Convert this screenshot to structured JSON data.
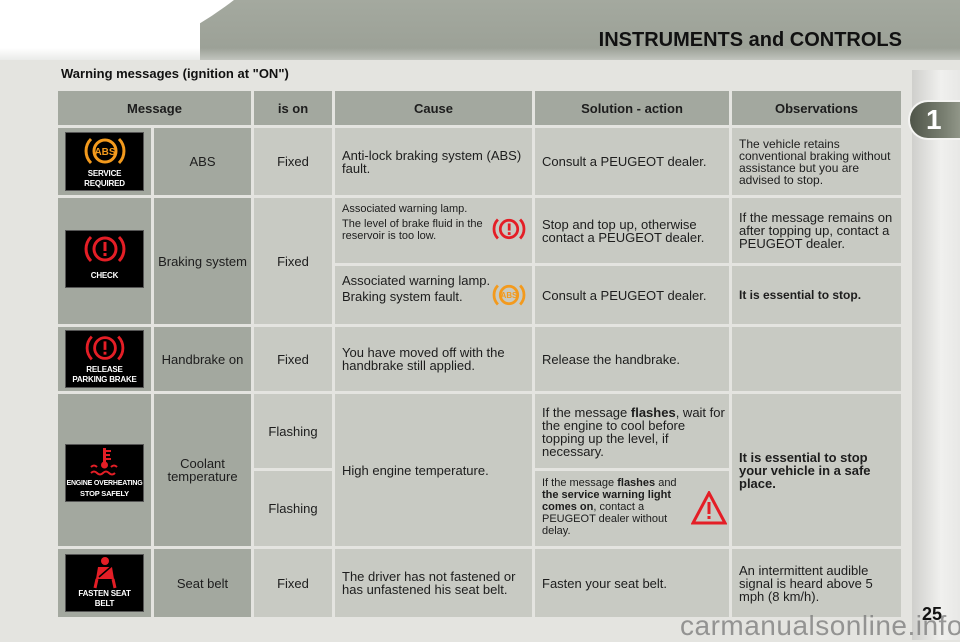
{
  "header": {
    "title": "INSTRUMENTS and CONTROLS",
    "section_title": "Warning messages (ignition at \"ON\")",
    "chapter_tab": "1",
    "page_number": "25",
    "watermark": "carmanualsonline.info"
  },
  "table": {
    "columns": [
      "Message",
      "is on",
      "Cause",
      "Solution - action",
      "Observations"
    ],
    "rows": [
      {
        "lamp_icon": "abs-icon",
        "lamp_label": [
          "SERVICE",
          "REQUIRED"
        ],
        "message": "ABS",
        "is_on": "Fixed",
        "cause": "Anti-lock braking system (ABS) fault.",
        "solution": "Consult a PEUGEOT dealer.",
        "observations": "The vehicle retains conventional braking without assistance but you are advised to stop."
      },
      {
        "lamp_icon": "brake-warning-icon",
        "lamp_label": [
          "CHECK"
        ],
        "message": "Braking system",
        "is_on": "Fixed",
        "sub": [
          {
            "cause_line1": "Associated warning lamp.",
            "cause_line2": "The level of brake fluid in the reservoir is too low.",
            "cause_icon": "brake-warning-icon",
            "solution": "Stop and top up, otherwise contact a PEUGEOT dealer.",
            "observations": "If the message remains on after topping up, contact a PEUGEOT dealer."
          },
          {
            "cause_line1": "Associated warning lamp.",
            "cause_line2": "Braking system fault.",
            "cause_icon": "abs-icon",
            "solution": "Consult a PEUGEOT dealer.",
            "observations": "It is essential to stop."
          }
        ]
      },
      {
        "lamp_icon": "brake-warning-icon",
        "lamp_label": [
          "RELEASE",
          "PARKING BRAKE"
        ],
        "message": "Handbrake on",
        "is_on": "Fixed",
        "cause": "You have moved off with the handbrake still applied.",
        "solution": "Release the handbrake.",
        "observations": ""
      },
      {
        "lamp_icon": "coolant-temperature-icon",
        "lamp_label": [
          "ENGINE OVERHEATING",
          "STOP SAFELY"
        ],
        "message": "Coolant temperature",
        "is_on_1": "Flashing",
        "is_on_2": "Flashing",
        "cause": "High engine temperature.",
        "solution_1_parts": [
          "If the message ",
          "flashes",
          ", wait for the engine to cool before topping up the level, if necessary."
        ],
        "solution_2_parts": [
          "If the message ",
          "flashes",
          " and ",
          "the service warning light comes on",
          ", contact a PEUGEOT dealer without delay."
        ],
        "solution_2_icon": "warning-triangle-icon",
        "observations": "It is essential to stop your vehicle in a safe place."
      },
      {
        "lamp_icon": "seat-belt-icon",
        "lamp_label": [
          "FASTEN SEAT",
          "BELT"
        ],
        "message": "Seat belt",
        "is_on": "Fixed",
        "cause": "The driver has not fastened or has unfastened his seat belt.",
        "solution": "Fasten your seat belt.",
        "observations": "An intermittent audible signal is heard above 5 mph (8 km/h)."
      }
    ]
  },
  "colors": {
    "header_gray": "#a3a89f",
    "cell_gray": "#c8cac3",
    "lamp_orange": "#f39a1d",
    "lamp_red": "#e41e26"
  }
}
